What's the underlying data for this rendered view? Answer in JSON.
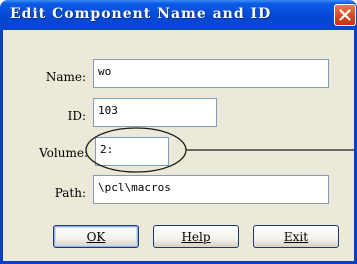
{
  "window": {
    "title": "Edit Component Name and ID"
  },
  "fields": {
    "name": {
      "label": "Name:",
      "value": "wo"
    },
    "id": {
      "label": "ID:",
      "value": "103"
    },
    "volume": {
      "label": "Volume:",
      "value": "2:"
    },
    "path": {
      "label": "Path:",
      "value": "\\pcl\\macros"
    }
  },
  "buttons": {
    "ok": "OK",
    "help": "Help",
    "exit": "Exit"
  },
  "colors": {
    "titlebar": "#0348d6",
    "close_button": "#d9441c",
    "dialog_bg": "#ece9d8"
  },
  "icons": {
    "close": "close-icon"
  }
}
